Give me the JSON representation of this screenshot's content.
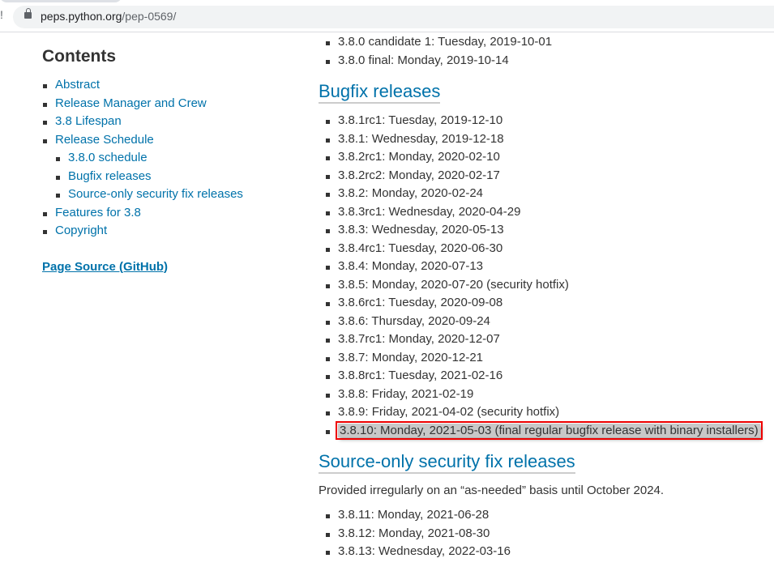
{
  "browser": {
    "url_host": "peps.python.org",
    "url_path": "/pep-0569/",
    "edge_glyph": "!"
  },
  "sidebar": {
    "title": "Contents",
    "items": [
      {
        "label": "Abstract"
      },
      {
        "label": "Release Manager and Crew"
      },
      {
        "label": "3.8 Lifespan"
      },
      {
        "label": "Release Schedule",
        "children": [
          {
            "label": "3.8.0 schedule"
          },
          {
            "label": "Bugfix releases"
          },
          {
            "label": "Source-only security fix releases"
          }
        ]
      },
      {
        "label": "Features for 3.8"
      },
      {
        "label": "Copyright"
      }
    ],
    "page_source": "Page Source (GitHub)"
  },
  "main": {
    "top_items": [
      "3.8.0 candidate 1: Tuesday, 2019-10-01",
      "3.8.0 final: Monday, 2019-10-14"
    ],
    "bugfix_heading": "Bugfix releases",
    "bugfix_items": [
      "3.8.1rc1: Tuesday, 2019-12-10",
      "3.8.1: Wednesday, 2019-12-18",
      "3.8.2rc1: Monday, 2020-02-10",
      "3.8.2rc2: Monday, 2020-02-17",
      "3.8.2: Monday, 2020-02-24",
      "3.8.3rc1: Wednesday, 2020-04-29",
      "3.8.3: Wednesday, 2020-05-13",
      "3.8.4rc1: Tuesday, 2020-06-30",
      "3.8.4: Monday, 2020-07-13",
      "3.8.5: Monday, 2020-07-20 (security hotfix)",
      "3.8.6rc1: Tuesday, 2020-09-08",
      "3.8.6: Thursday, 2020-09-24",
      "3.8.7rc1: Monday, 2020-12-07",
      "3.8.7: Monday, 2020-12-21",
      "3.8.8rc1: Tuesday, 2021-02-16",
      "3.8.8: Friday, 2021-02-19",
      "3.8.9: Friday, 2021-04-02 (security hotfix)"
    ],
    "highlighted_item": "3.8.10: Monday, 2021-05-03 (final regular bugfix release with binary installers)",
    "security_heading": "Source-only security fix releases",
    "security_intro": "Provided irregularly on an “as-needed” basis until October 2024.",
    "security_items": [
      "3.8.11: Monday, 2021-06-28",
      "3.8.12: Monday, 2021-08-30",
      "3.8.13: Wednesday, 2022-03-16"
    ]
  }
}
